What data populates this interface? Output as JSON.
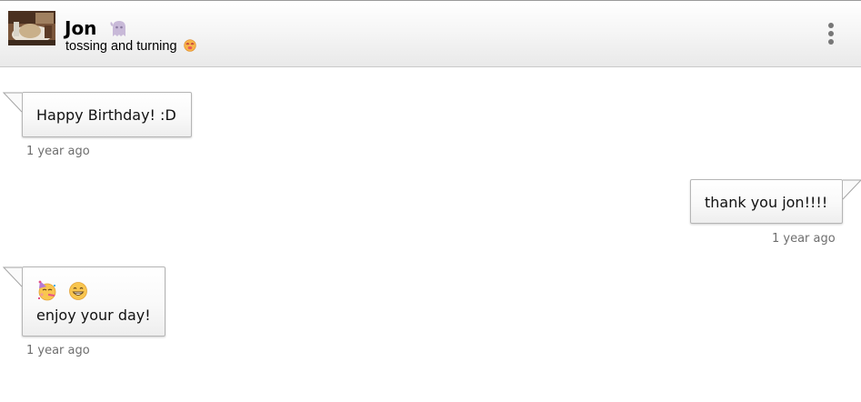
{
  "header": {
    "contact_name": "Jon",
    "status_text": "tossing and turning",
    "presence_icon": "ghost-icon",
    "status_emoji": "dizzy-face-emoji",
    "menu_icon": "more-vertical-icon"
  },
  "messages": [
    {
      "direction": "incoming",
      "text": "Happy Birthday! :D",
      "timestamp": "1 year ago"
    },
    {
      "direction": "outgoing",
      "text": "thank you jon!!!!",
      "timestamp": "1 year ago"
    },
    {
      "direction": "incoming",
      "emojis": [
        "partying-face-emoji",
        "grinning-face-emoji"
      ],
      "text": "enjoy your day!",
      "timestamp": "1 year ago"
    }
  ],
  "colors": {
    "bubble_border": "#b5b5b5",
    "timestamp": "#6e6e6e",
    "menu_dots": "#777777"
  }
}
